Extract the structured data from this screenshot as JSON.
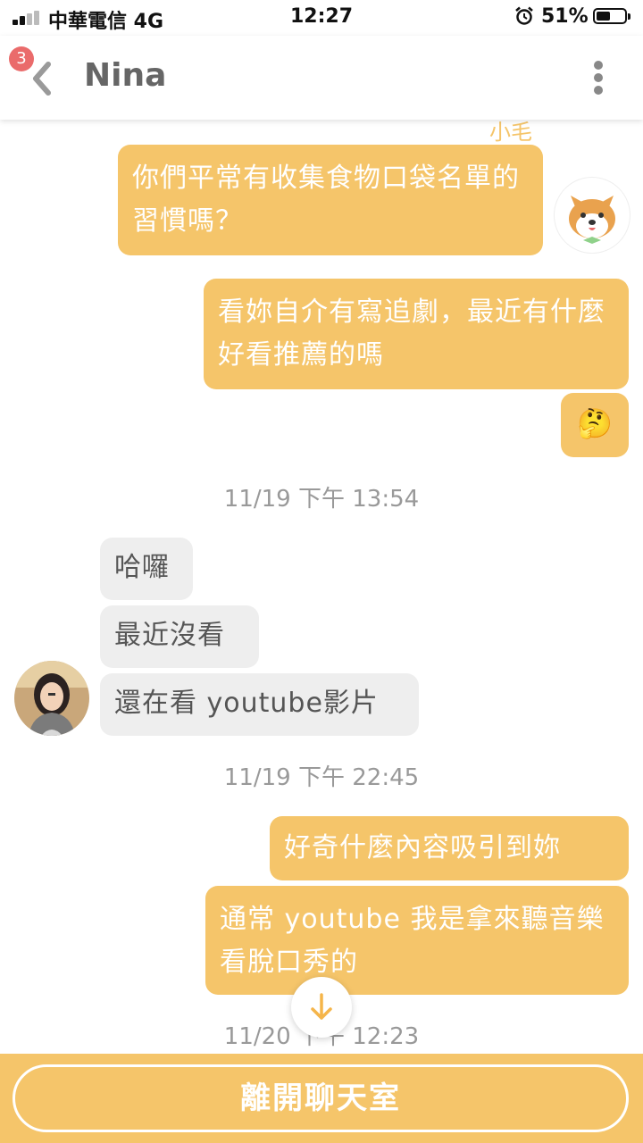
{
  "status_bar": {
    "carrier": "中華電信  4G",
    "time": "12:27",
    "battery": "51%",
    "battery_level": 0.51
  },
  "header": {
    "unread_badge": "3",
    "title": "Nina"
  },
  "chat": {
    "sender_name": "小毛",
    "messages": [
      {
        "id": "m1",
        "side": "out",
        "text": "你們平常有收集食物口袋名單的習慣嗎？"
      },
      {
        "id": "m2",
        "side": "out",
        "text": "看妳自介有寫追劇，最近有什麼好看推薦的嗎"
      },
      {
        "id": "m3",
        "side": "out",
        "text": "🤔"
      },
      {
        "id": "m4",
        "side": "in",
        "text": "哈囉"
      },
      {
        "id": "m5",
        "side": "in",
        "text": "最近沒看"
      },
      {
        "id": "m6",
        "side": "in",
        "text": "還在看 youtube影片"
      },
      {
        "id": "m7",
        "side": "out",
        "text": "好奇什麼內容吸引到妳"
      },
      {
        "id": "m8",
        "side": "out",
        "text": "通常 youtube 我是拿來聽音樂看脫口秀的"
      }
    ],
    "timestamps": [
      "11/19 下午 13:54",
      "11/19 下午 22:45",
      "11/20 下午 12:23"
    ]
  },
  "footer": {
    "leave_label": "離開聊天室"
  },
  "colors": {
    "accent": "#f5c56a",
    "incoming_bubble": "#eeeeee",
    "badge": "#ea6b6b"
  }
}
